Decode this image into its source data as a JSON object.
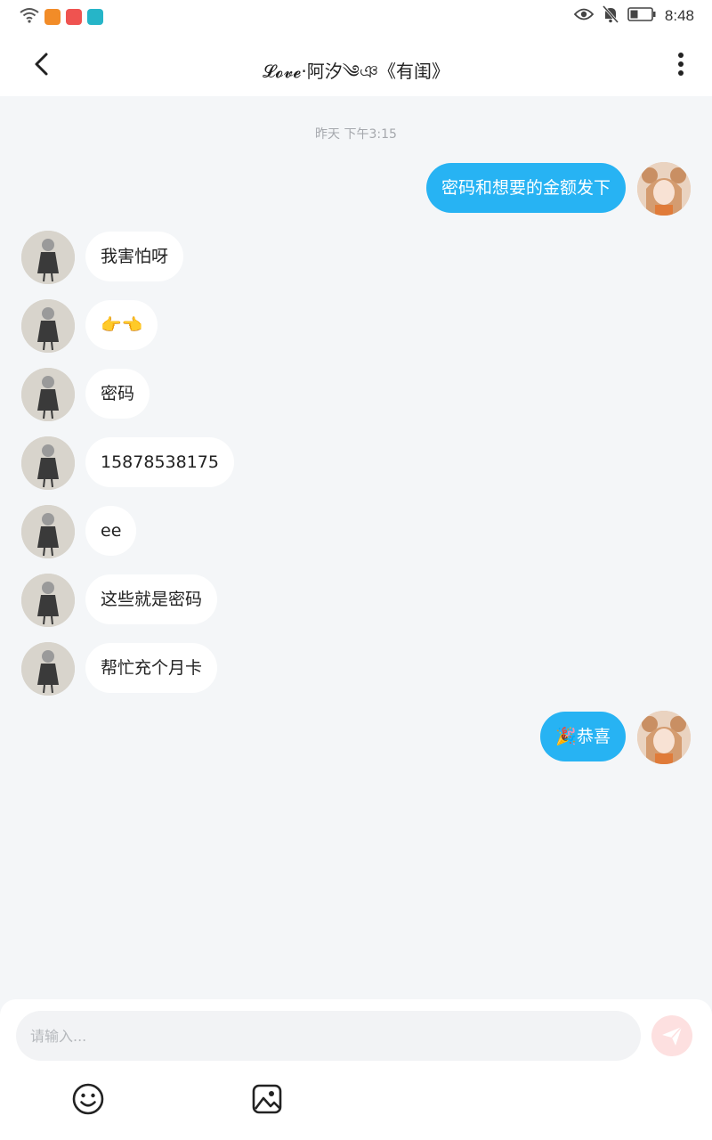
{
  "status_bar": {
    "time": "8:48",
    "left_icons": [
      "wifi-icon",
      "app-orange-icon",
      "app-red-icon",
      "app-teal-icon"
    ],
    "right_icons": [
      "eye-icon",
      "bell-muted-icon",
      "battery-icon"
    ]
  },
  "header": {
    "title": "𝓛𝓸𝓿𝓮·阿汐༄ঞ《有闺》",
    "back_icon": "chevron-left-icon",
    "more_icon": "more-vertical-icon"
  },
  "chat": {
    "timestamp": "昨天 下午3:15",
    "messages": [
      {
        "side": "out",
        "text": "密码和想要的金额发下"
      },
      {
        "side": "in",
        "text": "我害怕呀"
      },
      {
        "side": "in",
        "text": "👉👈"
      },
      {
        "side": "in",
        "text": "密码"
      },
      {
        "side": "in",
        "text": "15878538175"
      },
      {
        "side": "in",
        "text": "ee"
      },
      {
        "side": "in",
        "text": "这些就是密码"
      },
      {
        "side": "in",
        "text": "帮忙充个月卡"
      },
      {
        "side": "out",
        "text": "🎉恭喜"
      }
    ]
  },
  "composer": {
    "placeholder": "请输入...",
    "value": "",
    "send_icon": "send-icon",
    "emoji_icon": "emoji-icon",
    "image_icon": "image-icon"
  },
  "colors": {
    "outgoing_bubble": "#27b3f3",
    "incoming_bubble": "#ffffff",
    "background": "#f4f6f8",
    "send_button": "#fde0e0"
  }
}
